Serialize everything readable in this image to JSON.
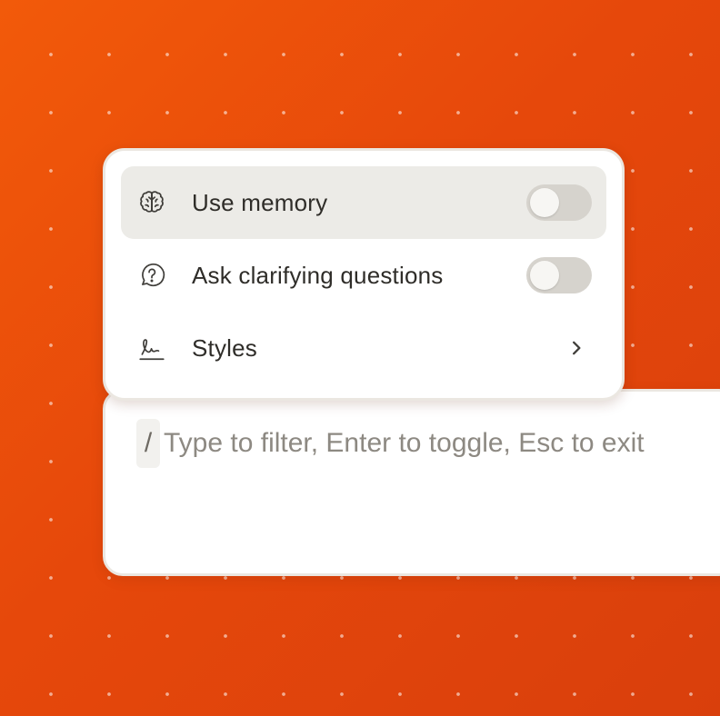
{
  "menu": {
    "items": [
      {
        "label": "Use memory",
        "icon": "brain-icon",
        "control": "toggle",
        "enabled": false,
        "highlighted": true
      },
      {
        "label": "Ask clarifying questions",
        "icon": "question-bubble-icon",
        "control": "toggle",
        "enabled": false,
        "highlighted": false
      },
      {
        "label": "Styles",
        "icon": "signature-icon",
        "control": "chevron-right-icon",
        "highlighted": false
      }
    ]
  },
  "input": {
    "slash": "/",
    "placeholder": "Type to filter, Enter to toggle, Esc to exit"
  },
  "colors": {
    "background_accent": "#e6480b",
    "toggle_off": "#d6d3cd",
    "highlight_row": "#ecebe7"
  }
}
